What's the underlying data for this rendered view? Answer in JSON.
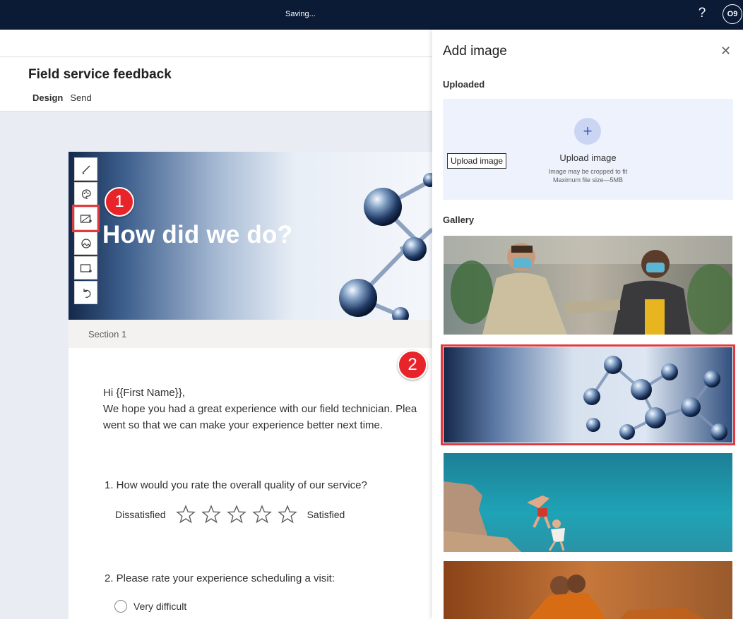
{
  "topbar": {
    "status": "Saving...",
    "help": "?",
    "avatar": "O9"
  },
  "header": {
    "title": "Field service feedback",
    "tabs": [
      "Design",
      "Send"
    ]
  },
  "survey": {
    "hero_title": "How did we do?",
    "section": "Section 1",
    "greeting": "Hi {{First Name}},",
    "intro_line1": "We hope you had a great experience with our field technician. Plea",
    "intro_line2": "went so that we can make your experience better next time.",
    "q1": "1. How would you rate the overall quality of our service?",
    "q1_low": "Dissatisfied",
    "q1_high": "Satisfied",
    "q1_star_count": 5,
    "q2": "2. Please rate your experience scheduling a visit:",
    "q2_option1": "Very difficult"
  },
  "callouts": {
    "one": "1",
    "two": "2"
  },
  "panel": {
    "title": "Add image",
    "uploaded_label": "Uploaded",
    "upload_tooltip": "Upload image",
    "upload_label": "Upload image",
    "hint1": "Image may be cropped to fit",
    "hint2": "Maximum file size—5MB",
    "gallery_label": "Gallery"
  },
  "colors": {
    "topbar": "#0b1a35",
    "highlight": "#e03a40",
    "callout": "#e8232a",
    "canvas": "#e9ecf3"
  }
}
